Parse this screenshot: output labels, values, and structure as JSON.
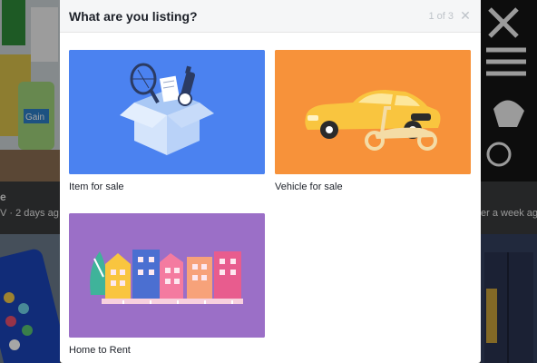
{
  "modal": {
    "title": "What are you listing?",
    "step": "1 of 3",
    "close_icon": "close-icon"
  },
  "options": [
    {
      "label": "Item for sale",
      "color": "#4b82f0",
      "icon": "box-illustration"
    },
    {
      "label": "Vehicle for sale",
      "color": "#f7923a",
      "icon": "car-scooter-illustration"
    },
    {
      "label": "Home to Rent",
      "color": "#9b6fc7",
      "icon": "houses-illustration"
    }
  ],
  "background": {
    "left_title": "e",
    "left_meta": "V · 2 days ag",
    "right_meta": "er a week ag"
  }
}
